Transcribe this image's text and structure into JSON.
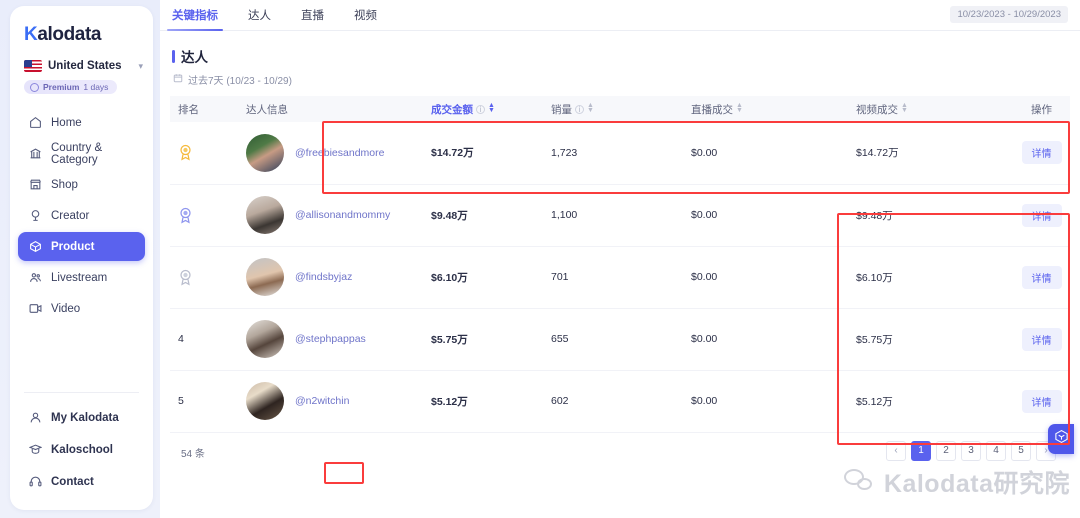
{
  "sidebar": {
    "logo": {
      "first_letter": "K",
      "rest": "alodata"
    },
    "country": {
      "label": "United States",
      "icon": "chevron-down-icon",
      "flag": "us-flag-icon"
    },
    "premium": {
      "label": "Premium",
      "days": "1 days"
    },
    "items": [
      {
        "label": "Home",
        "icon": "home-icon",
        "active": false
      },
      {
        "label": "Country & Category",
        "icon": "bank-icon",
        "active": false
      },
      {
        "label": "Shop",
        "icon": "store-icon",
        "active": false
      },
      {
        "label": "Creator",
        "icon": "creator-icon",
        "active": false
      },
      {
        "label": "Product",
        "icon": "product-box-icon",
        "active": true
      },
      {
        "label": "Livestream",
        "icon": "livestream-icon",
        "active": false
      },
      {
        "label": "Video",
        "icon": "video-icon",
        "active": false
      }
    ],
    "bottom_items": [
      {
        "label": "My Kalodata",
        "icon": "user-icon"
      },
      {
        "label": "Kaloschool",
        "icon": "graduation-cap-icon"
      },
      {
        "label": "Contact",
        "icon": "headset-icon"
      }
    ]
  },
  "topbar": {
    "tabs": [
      {
        "label": "关键指标",
        "active": true
      },
      {
        "label": "达人",
        "active": false
      },
      {
        "label": "直播",
        "active": false
      },
      {
        "label": "视频",
        "active": false
      }
    ],
    "date_range": "10/23/2023 - 10/29/2023"
  },
  "section": {
    "title": "达人",
    "subtitle": "过去7天 (10/23 - 10/29)",
    "calendar_icon": "calendar-icon"
  },
  "table": {
    "columns": [
      {
        "key": "rank",
        "label": "排名",
        "sortable": false,
        "info": false,
        "accent": false
      },
      {
        "key": "creator",
        "label": "达人信息",
        "sortable": false,
        "info": false,
        "accent": false
      },
      {
        "key": "gmv",
        "label": "成交金额",
        "sortable": true,
        "info": true,
        "accent": true
      },
      {
        "key": "sales",
        "label": "销量",
        "sortable": true,
        "info": true,
        "accent": false
      },
      {
        "key": "live_gmv",
        "label": "直播成交",
        "sortable": true,
        "info": false,
        "accent": false
      },
      {
        "key": "video_gmv",
        "label": "视频成交",
        "sortable": true,
        "info": false,
        "accent": false
      },
      {
        "key": "action",
        "label": "操作",
        "sortable": false,
        "info": false,
        "accent": false
      }
    ],
    "rows": [
      {
        "rank": "1",
        "rank_type": "medal-gold",
        "handle": "@freebiesandmore",
        "gmv": "$14.72万",
        "sales": "1,723",
        "live_gmv": "$0.00",
        "video_gmv": "$14.72万",
        "action": "详情"
      },
      {
        "rank": "2",
        "rank_type": "medal-silver",
        "handle": "@allisonandmommy",
        "gmv": "$9.48万",
        "sales": "1,100",
        "live_gmv": "$0.00",
        "video_gmv": "$9.48万",
        "action": "详情"
      },
      {
        "rank": "3",
        "rank_type": "medal-bronze",
        "handle": "@findsbyjaz",
        "gmv": "$6.10万",
        "sales": "701",
        "live_gmv": "$0.00",
        "video_gmv": "$6.10万",
        "action": "详情"
      },
      {
        "rank": "4",
        "rank_type": "number",
        "handle": "@stephpappas",
        "gmv": "$5.75万",
        "sales": "655",
        "live_gmv": "$0.00",
        "video_gmv": "$5.75万",
        "action": "详情"
      },
      {
        "rank": "5",
        "rank_type": "number",
        "handle": "@n2witchin",
        "gmv": "$5.12万",
        "sales": "602",
        "live_gmv": "$0.00",
        "video_gmv": "$5.12万",
        "action": "详情"
      }
    ]
  },
  "footer": {
    "count": "54 条",
    "pages": [
      "1",
      "2",
      "3",
      "4",
      "5"
    ],
    "active_page": "1",
    "prev_label": "‹",
    "next_label": "›"
  },
  "watermark": {
    "text": "Kalodata研究院",
    "icon": "wechat-icon"
  },
  "fab": {
    "icon": "cube-icon"
  },
  "colors": {
    "accent": "#5a62ee",
    "gmv_text": "#4b52d8",
    "handle_text": "#6f74c9",
    "annotation": "#fa3c3c",
    "medal_gold": "#f5b93c",
    "medal_silver": "#8e95ee",
    "medal_bronze": "#b9bdcd"
  }
}
